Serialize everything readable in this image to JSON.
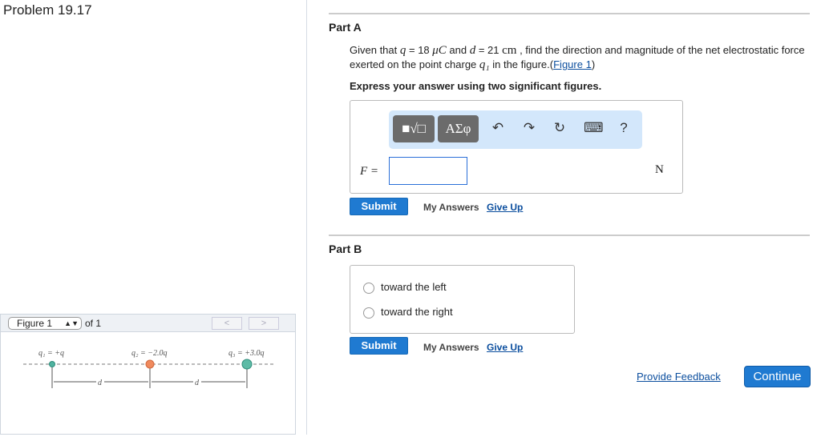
{
  "problem_title": "Problem 19.17",
  "figure_nav": {
    "selected": "Figure 1",
    "of_label": "of 1",
    "prev": "<",
    "next": ">"
  },
  "figure": {
    "q1_label": "q₁ = +q",
    "q2_label": "q₂ = −2.0q",
    "q3_label": "q₃ = +3.0q",
    "d_label": "d",
    "colors": {
      "q1": "#4fb3a0",
      "q2": "#f08a5d",
      "q3": "#5dbba6"
    }
  },
  "partA": {
    "title": "Part A",
    "q_pre": "Given that ",
    "q_var": "q",
    "q_eq": " = 18 ",
    "q_unit": "μC",
    "q_and": " and ",
    "d_var": "d",
    "d_eq": " = 21 ",
    "d_unit": "cm",
    "q_rest": " , find the direction and magnitude of the net electrostatic force exerted on the point charge ",
    "q1_var": "q₁",
    "q_end": " in the figure.(",
    "fig_link": "Figure 1",
    "close_paren": ")",
    "instruction": "Express your answer using two significant figures.",
    "toolbar": {
      "template_btn": "■√□",
      "greek_btn": "ΑΣφ",
      "undo": "↶",
      "redo": "↷",
      "reset": "↻",
      "keyboard": "⌨",
      "help": "?"
    },
    "answer_label": "F =",
    "answer_value": "",
    "unit": "N",
    "submit": "Submit",
    "my_answers": "My Answers",
    "give_up": "Give Up"
  },
  "partB": {
    "title": "Part B",
    "options": [
      "toward the left",
      "toward the right"
    ],
    "submit": "Submit",
    "my_answers": "My Answers",
    "give_up": "Give Up"
  },
  "footer": {
    "feedback": "Provide Feedback",
    "continue": "Continue"
  }
}
